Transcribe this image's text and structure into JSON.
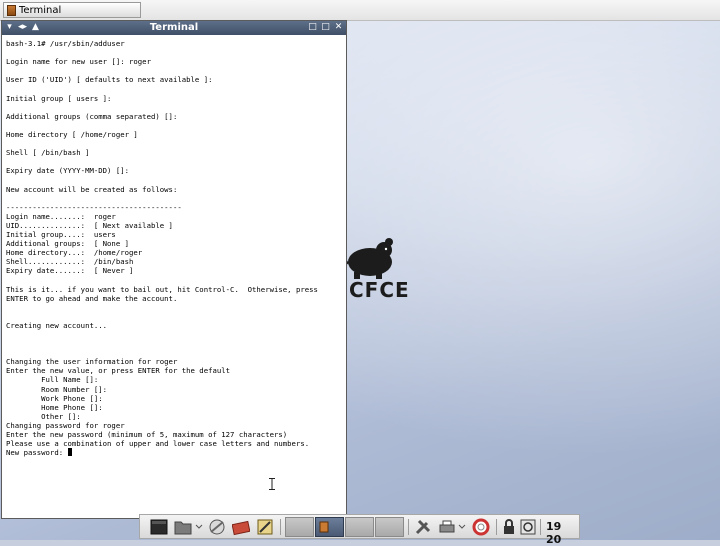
{
  "taskbar": {
    "task_label": "Terminal"
  },
  "window": {
    "title": "Terminal",
    "buttons_left": [
      "▾",
      "◂▸",
      "▲"
    ],
    "buttons_right": [
      "□",
      "□",
      "✕"
    ]
  },
  "terminal": {
    "lines": [
      "bash-3.1# /usr/sbin/adduser",
      "",
      "Login name for new user []: roger",
      "",
      "User ID ('UID') [ defaults to next available ]:",
      "",
      "Initial group [ users ]:",
      "",
      "Additional groups (comma separated) []:",
      "",
      "Home directory [ /home/roger ]",
      "",
      "Shell [ /bin/bash ]",
      "",
      "Expiry date (YYYY-MM-DD) []:",
      "",
      "New account will be created as follows:",
      "",
      "----------------------------------------",
      "Login name.......:  roger",
      "UID..............:  [ Next available ]",
      "Initial group....:  users",
      "Additional groups:  [ None ]",
      "Home directory...:  /home/roger",
      "Shell............:  /bin/bash",
      "Expiry date......:  [ Never ]",
      "",
      "This is it... if you want to bail out, hit Control-C.  Otherwise, press",
      "ENTER to go ahead and make the account.",
      "",
      "",
      "Creating new account...",
      "",
      "",
      "",
      "Changing the user information for roger",
      "Enter the new value, or press ENTER for the default",
      "        Full Name []:",
      "        Room Number []:",
      "        Work Phone []:",
      "        Home Phone []:",
      "        Other []:",
      "Changing password for roger",
      "Enter the new password (minimum of 5, maximum of 127 characters)",
      "Please use a combination of upper and lower case letters and numbers."
    ],
    "prompt": "New password: "
  },
  "desktop": {
    "logo_text": "CFCE"
  },
  "panel": {
    "clock": "19 20",
    "launchers": [
      "terminal-icon",
      "file-manager-icon",
      "browser-icon",
      "mail-icon",
      "editor-icon"
    ],
    "tray": [
      "settings-icon",
      "printer-icon",
      "help-icon",
      "lock-icon",
      "power-icon"
    ]
  },
  "colors": {
    "titlebar": "#4d5e78",
    "desktop": "#c7cfdf"
  }
}
